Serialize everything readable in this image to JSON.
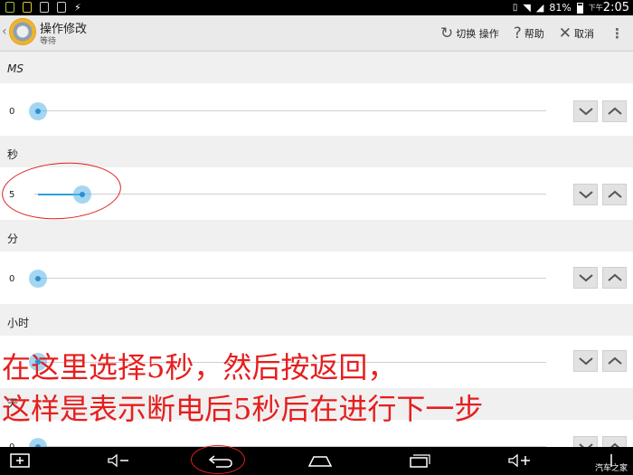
{
  "status_bar": {
    "battery": "81%",
    "period": "下午",
    "time": "2:05"
  },
  "action_bar": {
    "title": "操作修改",
    "subtitle": "等待",
    "switch_label": "切换 操作",
    "help_label": "帮助",
    "cancel_label": "取消"
  },
  "sections": [
    {
      "label": "MS",
      "value": "0",
      "fraction": 0
    },
    {
      "label": "秒",
      "value": "5",
      "fraction": 0.09
    },
    {
      "label": "分",
      "value": "0",
      "fraction": 0
    },
    {
      "label": "小时",
      "value": "",
      "fraction": 0
    },
    {
      "label": "天",
      "value": "0",
      "fraction": 0
    }
  ],
  "annotation": {
    "line1": "在这里选择5秒，然后按返回，",
    "line2": "这样是表示断电后5秒后在进行下一步",
    "color": "#e61e1e"
  },
  "watermark": "汽车之家"
}
